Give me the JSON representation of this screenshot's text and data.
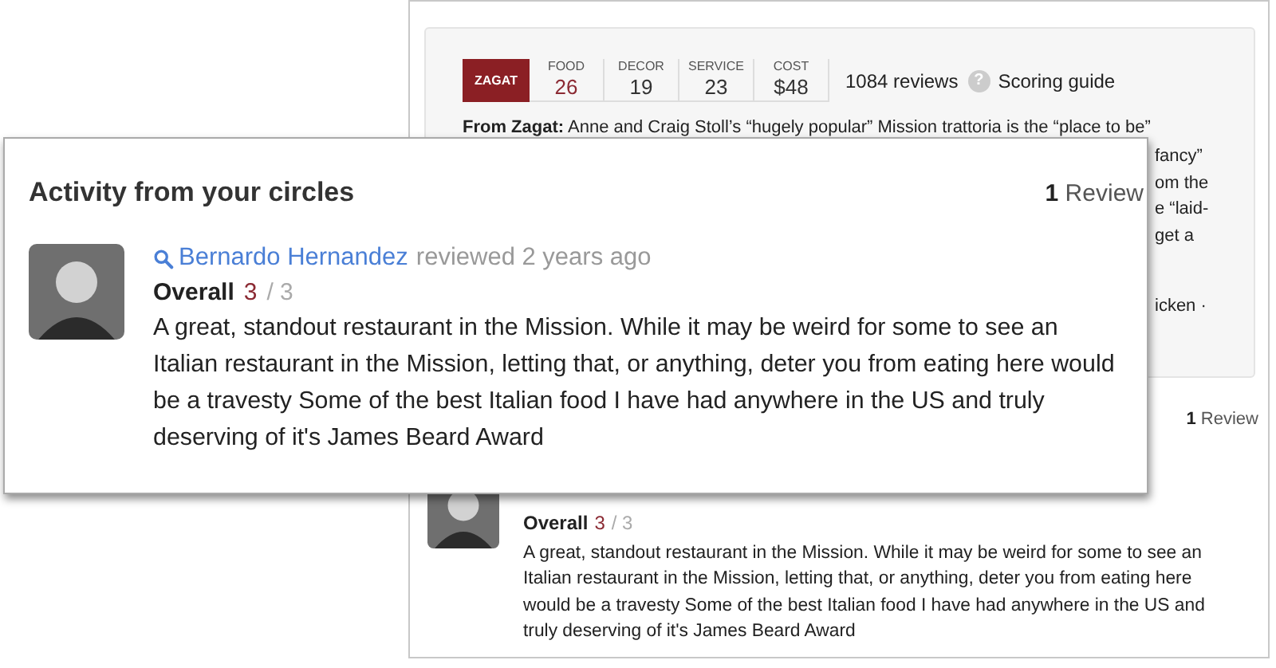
{
  "page": {
    "zagat": {
      "logo": "ZAGAT",
      "scores": [
        {
          "label": "FOOD",
          "value": "26",
          "color": "#8b2a33"
        },
        {
          "label": "DECOR",
          "value": "19",
          "color": "#333333"
        },
        {
          "label": "SERVICE",
          "value": "23",
          "color": "#333333"
        },
        {
          "label": "COST",
          "value": "$48",
          "color": "#333333"
        }
      ],
      "reviews": "1084 reviews",
      "help_icon": "?",
      "scoring_guide": "Scoring guide"
    },
    "from_zagat": "**From Zagat:** Anne and Craig Stoll’s “hugely popular” Mission trattoria is the “place to be”",
    "description_fragments": [
      "fancy”",
      "om the",
      "e “laid-",
      "get a",
      "icken ·"
    ],
    "review_count": {
      "number": "1",
      "label": "Review"
    },
    "review": {
      "overall_label": "Overall",
      "score": "3",
      "max": "/ 3",
      "text": "A great, standout restaurant in the Mission. While it may be weird for some to see an Italian restaurant in the Mission, letting that, or anything, deter you from eating here would be a travesty Some of the best Italian food I have had anywhere in the US and truly deserving of it's James Beard Award"
    }
  },
  "overlay": {
    "title": "Activity from your circles",
    "review_count": {
      "number": "1",
      "label": "Review"
    },
    "review": {
      "author": "Bernardo Hernandez",
      "action": "reviewed 2 years ago",
      "overall_label": "Overall",
      "score": "3",
      "max": "/ 3",
      "text": "A great, standout restaurant in the Mission. While it may be weird for some to see an Italian restaurant in the Mission, letting that, or anything, deter you from eating here would be a travesty Some of the best Italian food I have had anywhere in the US and truly deserving of it's James Beard Award"
    }
  }
}
